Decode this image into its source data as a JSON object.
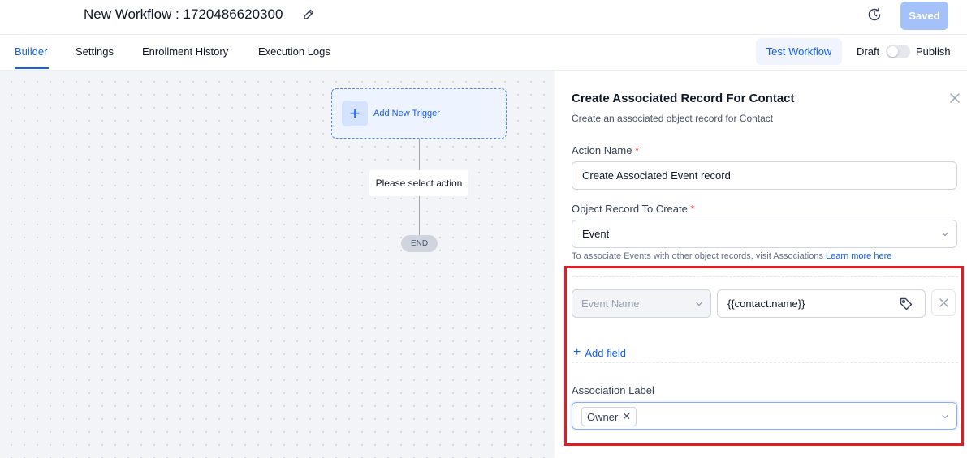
{
  "header": {
    "title": "New Workflow : 1720486620300",
    "saved_label": "Saved"
  },
  "tabs": [
    {
      "label": "Builder",
      "active": true
    },
    {
      "label": "Settings",
      "active": false
    },
    {
      "label": "Enrollment History",
      "active": false
    },
    {
      "label": "Execution Logs",
      "active": false
    }
  ],
  "toolbar": {
    "test_label": "Test Workflow",
    "draft_label": "Draft",
    "publish_label": "Publish",
    "published": false
  },
  "canvas": {
    "trigger_label": "Add New Trigger",
    "action_label": "Please select action",
    "end_label": "END"
  },
  "panel": {
    "title": "Create Associated Record For Contact",
    "subtitle": "Create an associated object record for Contact",
    "action_name_label": "Action Name",
    "action_name_value": "Create Associated Event record",
    "object_label": "Object Record To Create",
    "object_value": "Event",
    "helper_text": "To associate Events with other object records, visit Associations",
    "helper_link": "Learn more here",
    "field_row": {
      "field_placeholder": "Event Name",
      "value": "{{contact.name}}"
    },
    "add_field_label": "Add field",
    "association_label": "Association Label",
    "association_chips": [
      "Owner"
    ],
    "required_marker": "*"
  },
  "colors": {
    "accent": "#155eef",
    "highlight": "#e31b23",
    "saved_button": "#a4c1f9"
  },
  "icons": [
    "edit-icon",
    "history-icon",
    "plus-icon",
    "close-icon",
    "chevron-down-icon",
    "tag-icon"
  ]
}
